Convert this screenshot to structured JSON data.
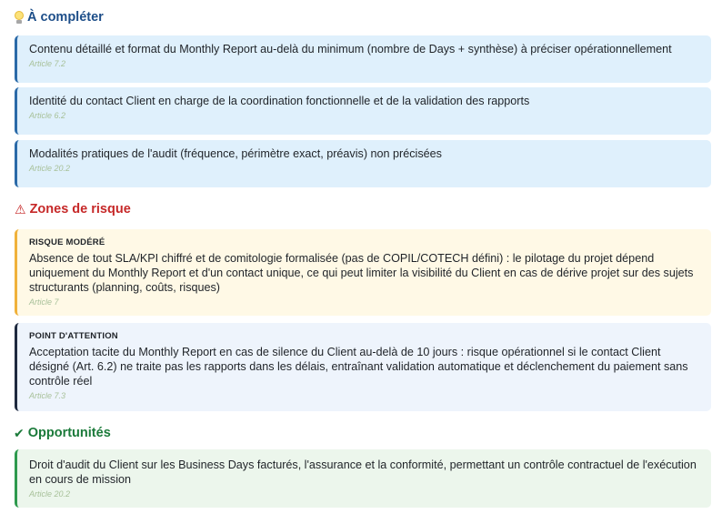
{
  "sections": {
    "complete": {
      "title": "À compléter",
      "icon": "lightbulb-icon",
      "color": "#1d4e89",
      "items": [
        {
          "text": "Contenu détaillé et format du Monthly Report au-delà du minimum (nombre de Days + synthèse) à préciser opérationnellement",
          "ref": "Article 7.2"
        },
        {
          "text": "Identité du contact Client en charge de la coordination fonctionnelle et de la validation des rapports",
          "ref": "Article 6.2"
        },
        {
          "text": "Modalités pratiques de l'audit (fréquence, périmètre exact, préavis) non précisées",
          "ref": "Article 20.2"
        }
      ]
    },
    "risks": {
      "title": "Zones de risque",
      "icon": "warning-icon",
      "color": "#c62828",
      "items": [
        {
          "tag": "RISQUE MODÉRÉ",
          "text": "Absence de tout SLA/KPI chiffré et de comitologie formalisée (pas de COPIL/COTECH défini) : le pilotage du projet dépend uniquement du Monthly Report et d'un contact unique, ce qui peut limiter la visibilité du Client en cas de dérive projet sur des sujets structurants (planning, coûts, risques)",
          "ref": "Article 7",
          "accent": "#f0b13a"
        },
        {
          "tag": "POINT D'ATTENTION",
          "text": "Acceptation tacite du Monthly Report en cas de silence du Client au-delà de 10 jours : risque opérationnel si le contact Client désigné (Art. 6.2) ne traite pas les rapports dans les délais, entraînant validation automatique et déclenchement du paiement sans contrôle réel",
          "ref": "Article 7.3",
          "accent": "#1f2a3f"
        }
      ]
    },
    "opportunities": {
      "title": "Opportunités",
      "icon": "checkmark-icon",
      "color": "#1b7a3a",
      "items": [
        {
          "text": "Droit d'audit du Client sur les Business Days facturés, l'assurance et la conformité, permettant un contrôle contractuel de l'exécution en cours de mission",
          "ref": "Article 20.2"
        }
      ]
    }
  }
}
